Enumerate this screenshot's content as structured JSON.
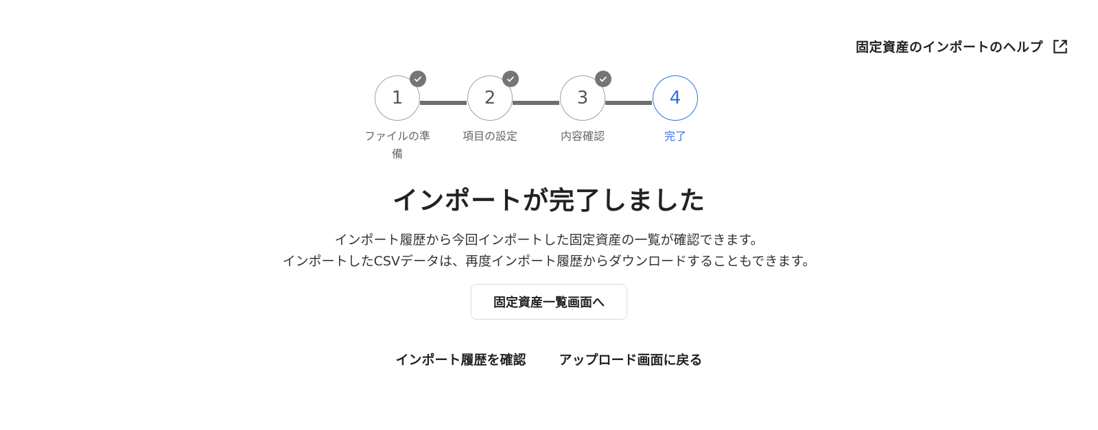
{
  "help": {
    "label": "固定資産のインポートのヘルプ",
    "icon": "external-link-icon"
  },
  "stepper": {
    "steps": [
      {
        "number": "1",
        "label": "ファイルの準備",
        "status": "completed"
      },
      {
        "number": "2",
        "label": "項目の設定",
        "status": "completed"
      },
      {
        "number": "3",
        "label": "内容確認",
        "status": "completed"
      },
      {
        "number": "4",
        "label": "完了",
        "status": "current"
      }
    ],
    "check_icon": "check-icon"
  },
  "main": {
    "title": "インポートが完了しました",
    "description_line1": "インポート履歴から今回インポートした固定資産の一覧が確認できます。",
    "description_line2": "インポートしたCSVデータは、再度インポート履歴からダウンロードすることもできます。",
    "primary_button": "固定資産一覧画面へ",
    "link_history": "インポート履歴を確認",
    "link_upload": "アップロード画面に戻る"
  },
  "colors": {
    "accent": "#2f6fe0",
    "completed": "#757575",
    "text": "#222222"
  }
}
